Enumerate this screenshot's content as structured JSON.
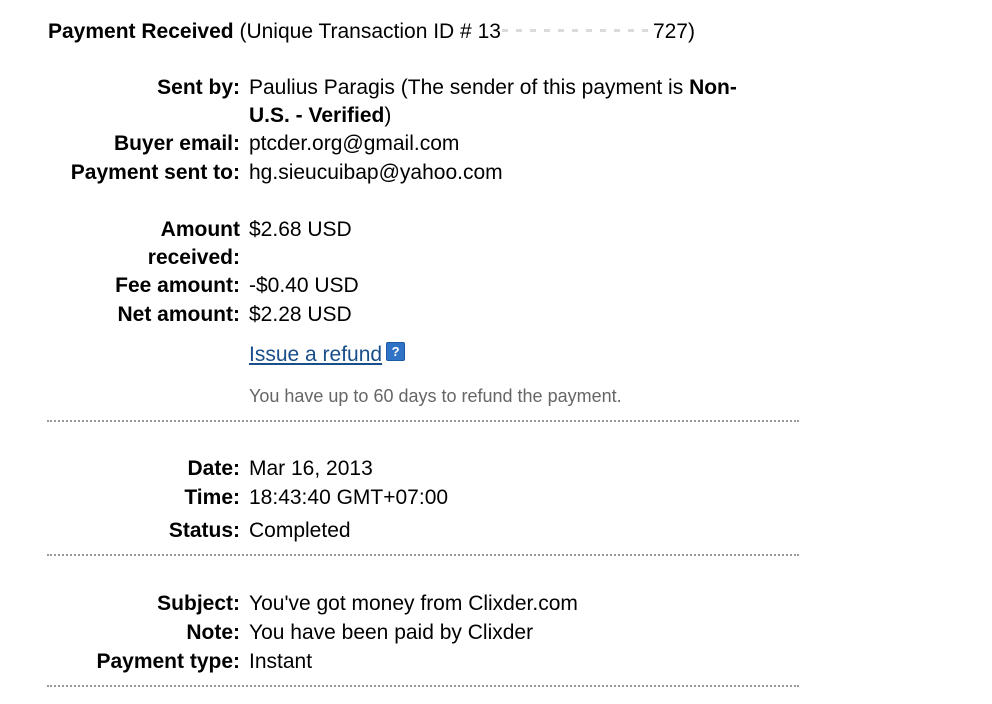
{
  "header": {
    "title": "Payment Received",
    "transaction_prefix": "(Unique Transaction ID # 13",
    "transaction_suffix": "727)"
  },
  "sender": {
    "sent_by_label": "Sent by:",
    "sent_by_name": "Paulius Paragis (The sender of this payment is",
    "sender_status_line1": "Non-",
    "sender_status_line2": "U.S. - Verified",
    "sender_close": ")",
    "buyer_email_label": "Buyer email:",
    "buyer_email": "ptcder.org@gmail.com",
    "sent_to_label": "Payment sent to:",
    "sent_to": "hg.sieucuibap@yahoo.com"
  },
  "amounts": {
    "received_label_1": "Amount",
    "received_label_2": "received:",
    "received": "$2.68 USD",
    "fee_label": "Fee amount:",
    "fee": "-$0.40 USD",
    "net_label": "Net amount:",
    "net": "$2.28 USD",
    "refund_link": "Issue a refund",
    "help_icon": "?",
    "refund_note": "You have up to 60 days to refund the payment."
  },
  "timing": {
    "date_label": "Date:",
    "date": "Mar 16, 2013",
    "time_label": "Time:",
    "time": "18:43:40 GMT+07:00",
    "status_label": "Status:",
    "status": "Completed"
  },
  "details": {
    "subject_label": "Subject:",
    "subject": "You've got money from Clixder.com",
    "note_label": "Note:",
    "note": "You have been paid by Clixder",
    "type_label": "Payment type:",
    "type": "Instant"
  },
  "colors": {
    "link": "#184e8a",
    "help_icon_bg": "#2f73c7",
    "muted_text": "#666666",
    "divider": "#9a9a9a"
  }
}
